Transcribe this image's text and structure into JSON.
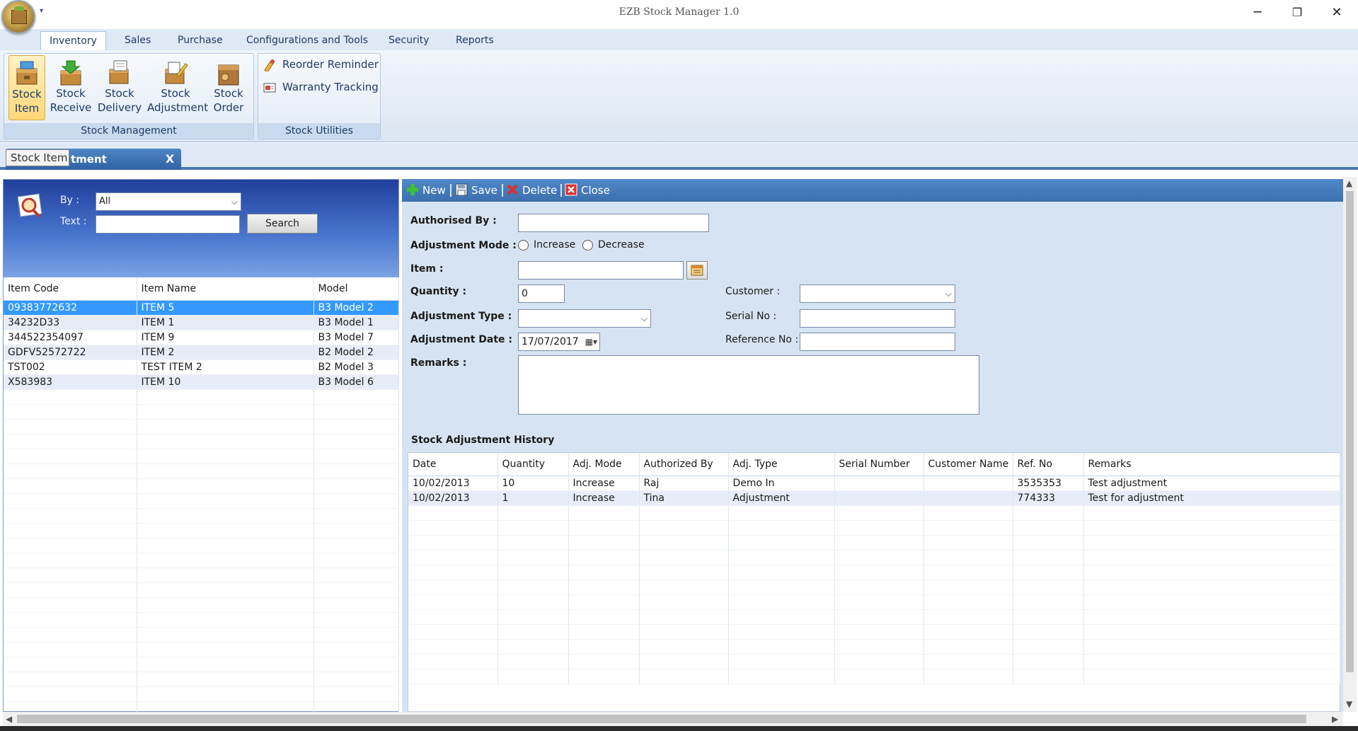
{
  "window": {
    "title": "EZB Stock Manager 1.0",
    "minimize": "─",
    "restore": "❐",
    "close": "✕"
  },
  "ribbon": {
    "tabs": [
      "Inventory",
      "Sales",
      "Purchase",
      "Configurations and Tools",
      "Security",
      "Reports"
    ],
    "active_tab": "Inventory",
    "stock_management": {
      "caption": "Stock Management",
      "buttons": [
        {
          "line1": "Stock",
          "line2": "Item",
          "icon": "stock-item-icon"
        },
        {
          "line1": "Stock",
          "line2": "Receive",
          "icon": "stock-receive-icon"
        },
        {
          "line1": "Stock",
          "line2": "Delivery",
          "icon": "stock-delivery-icon"
        },
        {
          "line1": "Stock",
          "line2": "Adjustment",
          "icon": "stock-adjustment-icon"
        },
        {
          "line1": "Stock",
          "line2": "Order",
          "icon": "stock-order-icon"
        }
      ]
    },
    "stock_utilities": {
      "caption": "Stock Utilities",
      "reorder": "Reorder Reminder",
      "warranty": "Warranty Tracking"
    }
  },
  "doc_tab": {
    "label": "tment",
    "tooltip": "Stock Item",
    "close": "X"
  },
  "search": {
    "by_label": "By :",
    "by_value": "All",
    "text_label": "Text :",
    "text_value": "",
    "button": "Search"
  },
  "items_grid": {
    "columns": [
      "Item Code",
      "Item Name",
      "Model"
    ],
    "rows": [
      [
        "09383772632",
        "ITEM 5",
        "B3 Model 2"
      ],
      [
        "34232D33",
        "ITEM 1",
        "B3 Model 1"
      ],
      [
        "344522354097",
        "ITEM 9",
        "B3 Model 7"
      ],
      [
        "GDFV52572722",
        "ITEM 2",
        "B2 Model 2"
      ],
      [
        "TST002",
        "TEST ITEM 2",
        "B2 Model 3"
      ],
      [
        "X583983",
        "ITEM 10",
        "B3 Model 6"
      ]
    ]
  },
  "toolbar": {
    "new": "New",
    "save": "Save",
    "delete": "Delete",
    "close": "Close"
  },
  "form": {
    "authorised_by_label": "Authorised By :",
    "authorised_by_value": "",
    "adjustment_mode_label": "Adjustment Mode :",
    "increase_label": "Increase",
    "decrease_label": "Decrease",
    "item_label": "Item :",
    "item_value": "",
    "quantity_label": "Quantity :",
    "quantity_value": "0",
    "customer_label": "Customer :",
    "customer_value": "",
    "adjustment_type_label": "Adjustment Type :",
    "adjustment_type_value": "",
    "serial_no_label": "Serial No :",
    "serial_no_value": "",
    "adjustment_date_label": "Adjustment Date :",
    "adjustment_date_value": "17/07/2017",
    "reference_no_label": "Reference No :",
    "reference_no_value": "",
    "remarks_label": "Remarks :",
    "remarks_value": ""
  },
  "history": {
    "title": "Stock Adjustment History",
    "columns": [
      "Date",
      "Quantity",
      "Adj. Mode",
      "Authorized By",
      "Adj. Type",
      "Serial Number",
      "Customer Name",
      "Ref. No",
      "Remarks"
    ],
    "rows": [
      [
        "10/02/2013",
        "10",
        "Increase",
        "Raj",
        "Demo In",
        "",
        "",
        "3535353",
        "Test adjustment"
      ],
      [
        "10/02/2013",
        "1",
        "Increase",
        "Tina",
        "Adjustment",
        "",
        "",
        "774333",
        "Test for adjustment"
      ]
    ]
  },
  "colors": {
    "ribbon_bg": "#dfe9f5",
    "toolbar_blue": "#3c6fae",
    "selection": "#3399ff",
    "alt_row": "#e8ecf8"
  }
}
